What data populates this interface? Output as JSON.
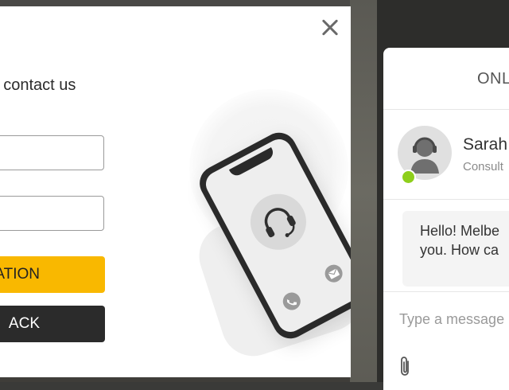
{
  "modal": {
    "heading": "r contact us",
    "field1_value": "",
    "field2_value": "",
    "primary_button_label": "ATION",
    "secondary_button_label": "ACK",
    "close_icon": "close-icon",
    "illustration_icons": [
      "headset-icon",
      "phone-call-icon",
      "mail-icon"
    ]
  },
  "chat": {
    "title": "ONL",
    "agent_name": "Sarah",
    "agent_role": "Consult",
    "status_color": "#8ecf1b",
    "message": "Hello! Melbe\nyou. How ca",
    "input_placeholder": "Type a message",
    "attach_icon": "paperclip-icon"
  },
  "colors": {
    "accent_yellow": "#f9b800",
    "dark_button": "#2b2b2b"
  }
}
